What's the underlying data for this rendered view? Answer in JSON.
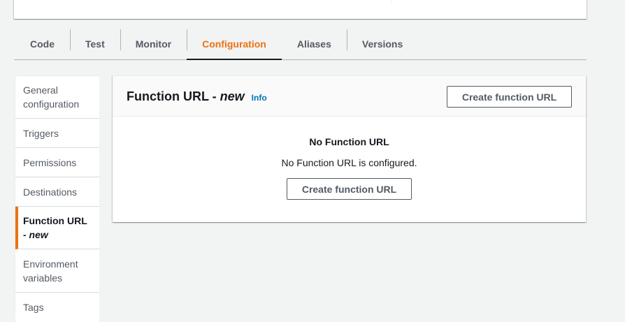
{
  "tabs": [
    {
      "label": "Code"
    },
    {
      "label": "Test"
    },
    {
      "label": "Monitor"
    },
    {
      "label": "Configuration",
      "active": true
    },
    {
      "label": "Aliases"
    },
    {
      "label": "Versions"
    }
  ],
  "sidebar": {
    "items": [
      {
        "label": "General\nconfiguration"
      },
      {
        "label": "Triggers"
      },
      {
        "label": "Permissions"
      },
      {
        "label": "Destinations"
      },
      {
        "label": "Function URL",
        "label_new": "- new",
        "active": true
      },
      {
        "label": "Environment\nvariables"
      },
      {
        "label": "Tags"
      }
    ]
  },
  "panel": {
    "title": "Function URL -",
    "title_new": "new",
    "info_label": "Info",
    "create_button": "Create function URL",
    "empty_title": "No Function URL",
    "empty_description": "No Function URL is configured.",
    "empty_create_button": "Create function URL"
  },
  "colors": {
    "accent": "#ec7211",
    "link": "#0073bb",
    "background": "#f2f3f3"
  }
}
